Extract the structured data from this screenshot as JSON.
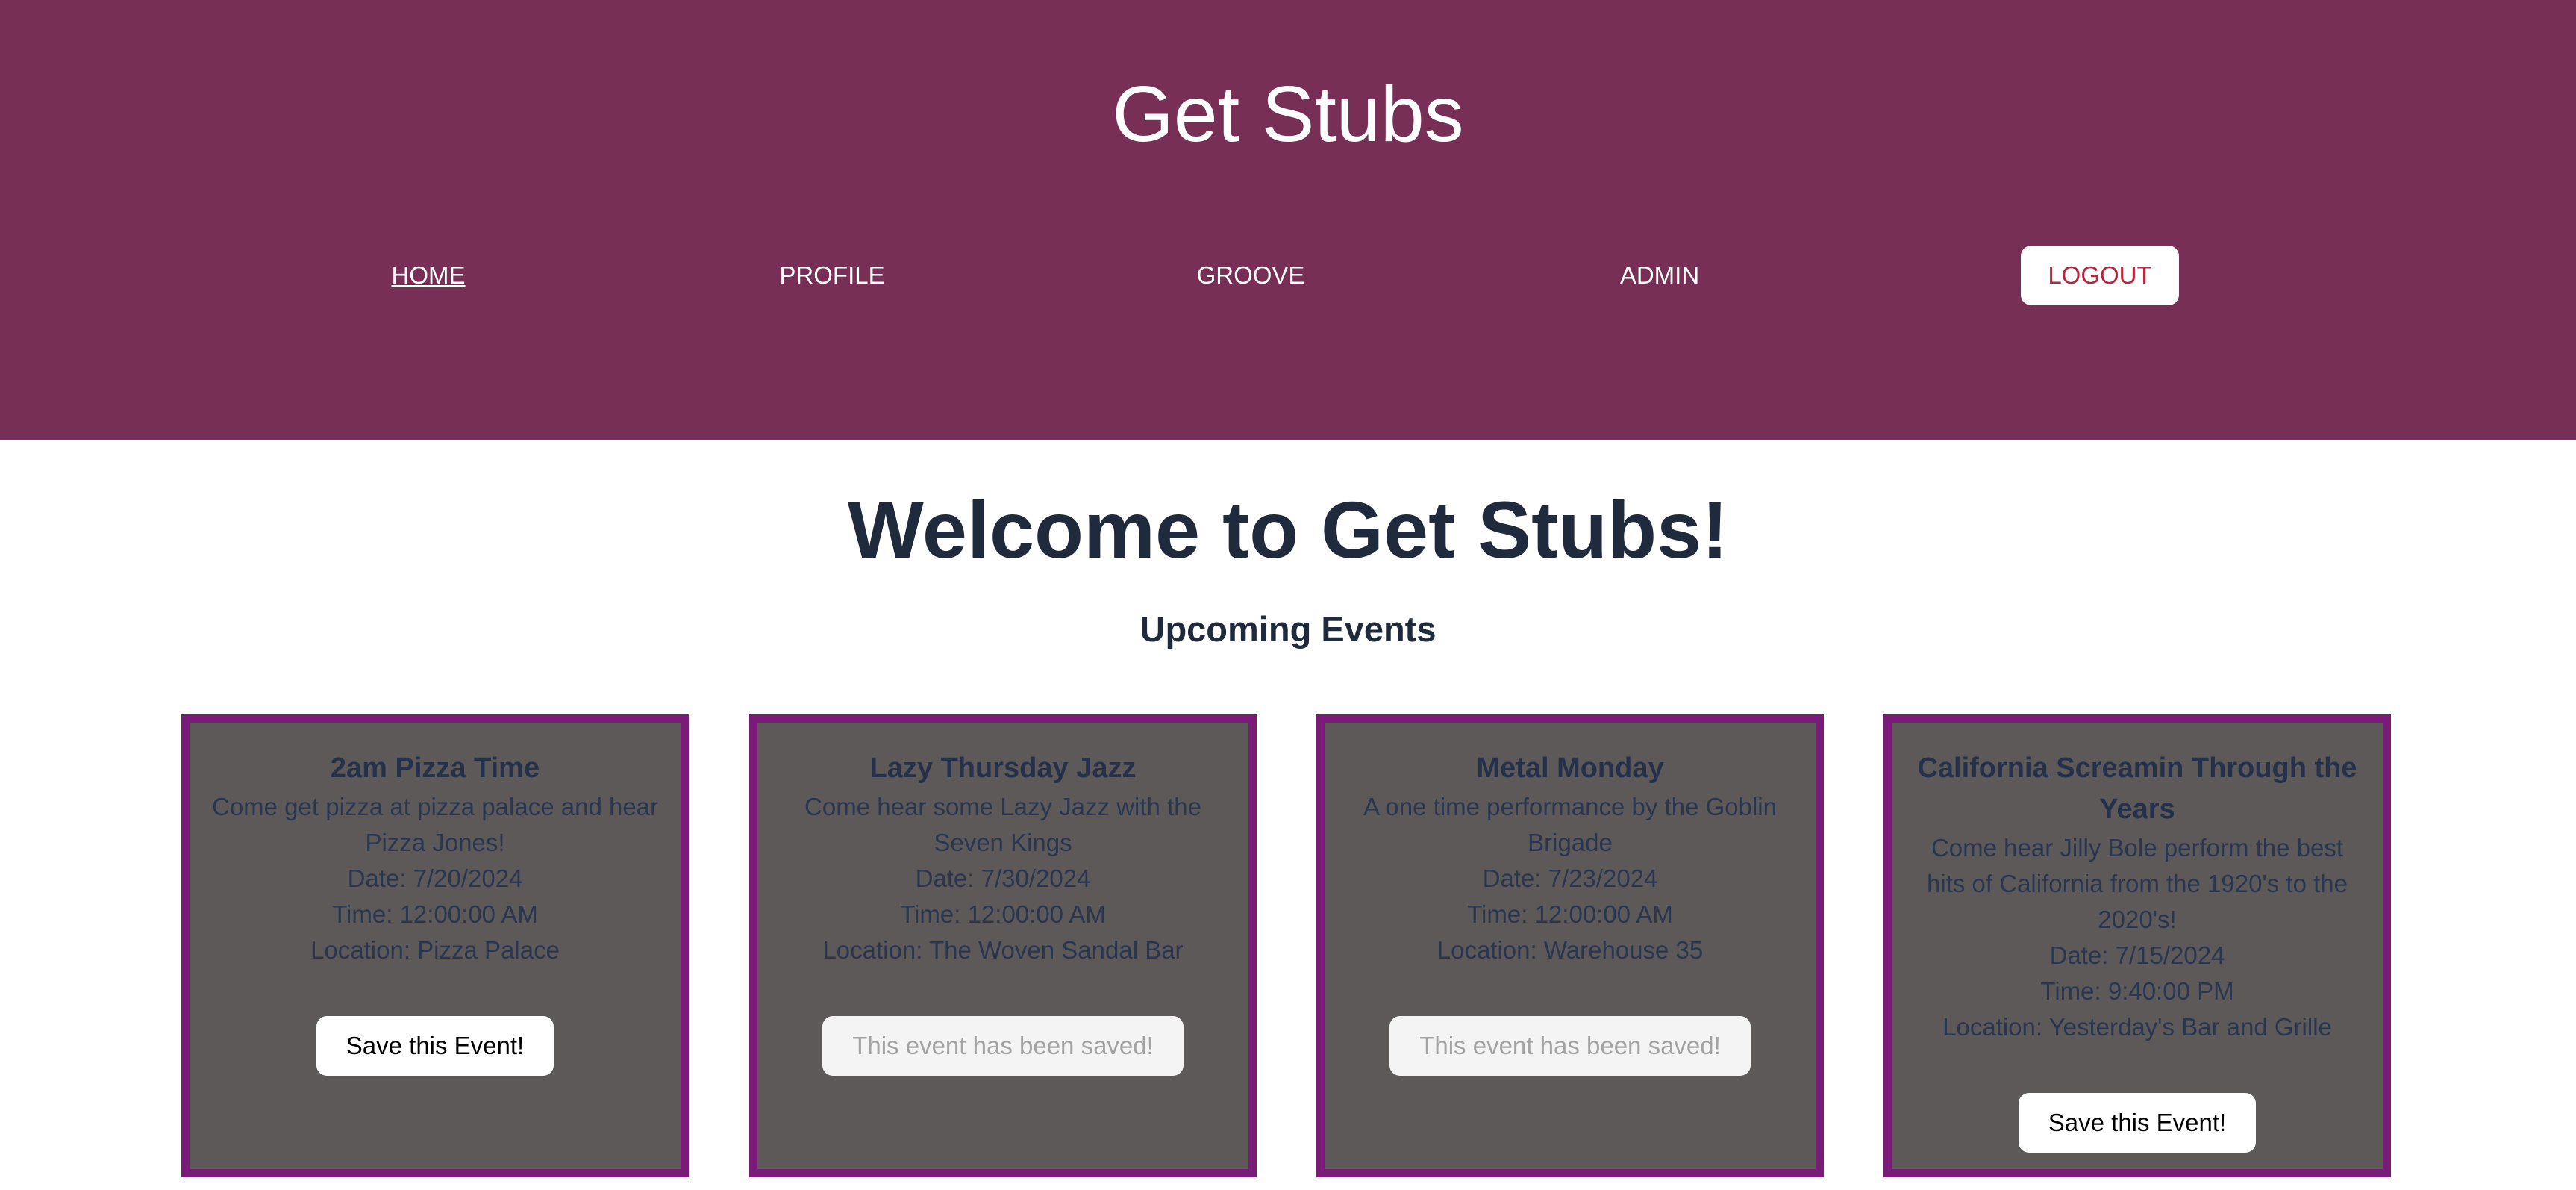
{
  "header": {
    "title": "Get Stubs",
    "nav": [
      {
        "label": "HOME",
        "active": true
      },
      {
        "label": "PROFILE",
        "active": false
      },
      {
        "label": "GROOVE",
        "active": false
      },
      {
        "label": "ADMIN",
        "active": false
      }
    ],
    "logout_label": "LOGOUT",
    "colors": {
      "background": "#782f55",
      "logout_text": "#b8263e"
    }
  },
  "main": {
    "welcome": "Welcome to Get Stubs!",
    "subheading": "Upcoming Events"
  },
  "events": [
    {
      "title": "2am Pizza Time",
      "description": "Come get pizza at pizza palace and hear Pizza Jones!",
      "date": "Date: 7/20/2024",
      "time": "Time: 12:00:00 AM",
      "location": "Location: Pizza Palace",
      "button_label": "Save this Event!",
      "saved": false
    },
    {
      "title": "Lazy Thursday Jazz",
      "description": "Come hear some Lazy Jazz with the Seven Kings",
      "date": "Date: 7/30/2024",
      "time": "Time: 12:00:00 AM",
      "location": "Location: The Woven Sandal Bar",
      "button_label": "This event has been saved!",
      "saved": true
    },
    {
      "title": "Metal Monday",
      "description": "A one time performance by the Goblin Brigade",
      "date": "Date: 7/23/2024",
      "time": "Time: 12:00:00 AM",
      "location": "Location: Warehouse 35",
      "button_label": "This event has been saved!",
      "saved": true
    },
    {
      "title": "California Screamin Through the Years",
      "description": "Come hear Jilly Bole perform the best hits of California from the 1920's to the 2020's!",
      "date": "Date: 7/15/2024",
      "time": "Time: 9:40:00 PM",
      "location": "Location: Yesterday's Bar and Grille",
      "button_label": "Save this Event!",
      "saved": false
    }
  ]
}
